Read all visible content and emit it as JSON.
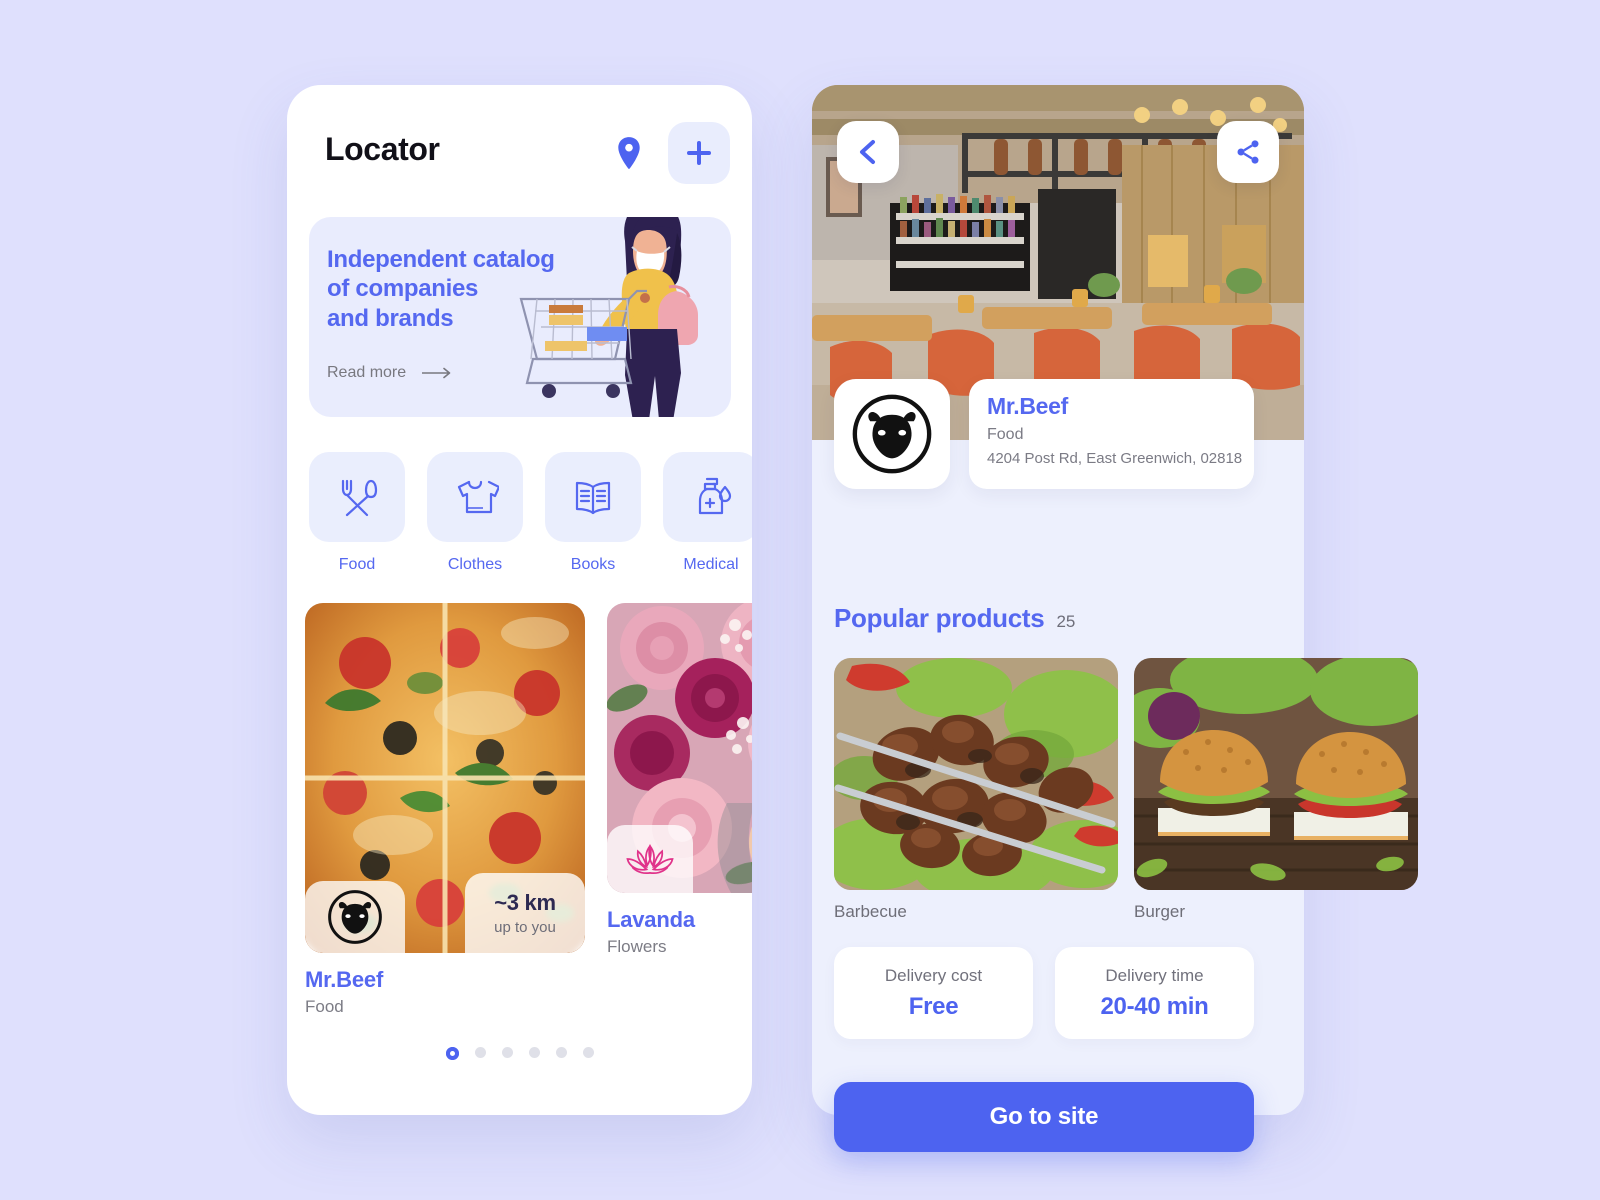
{
  "left_panel": {
    "app_title": "Locator",
    "header_icons": {
      "pin": "location-pin-icon",
      "add": "plus-icon"
    },
    "banner": {
      "title": "Independent catalog\nof companies\nand brands",
      "title_line1": "Independent catalog",
      "title_line2": "of companies",
      "title_line3": "and brands",
      "link_label": "Read more",
      "arrow": "arrow-right-icon",
      "illustration": "woman-with-shopping-cart"
    },
    "categories": [
      {
        "label": "Food",
        "icon": "fork-spoon-icon"
      },
      {
        "label": "Clothes",
        "icon": "tshirt-icon"
      },
      {
        "label": "Books",
        "icon": "open-book-icon"
      },
      {
        "label": "Medical",
        "icon": "sanitizer-bottle-icon"
      }
    ],
    "shops": [
      {
        "name": "Mr.Beef",
        "category": "Food",
        "logo": "cow-head-icon",
        "distance": "~3 km",
        "distance_sub": "up to you",
        "image": "pizza-photo"
      },
      {
        "name": "Lavanda",
        "category": "Flowers",
        "logo": "lotus-flower-icon",
        "image": "flower-bouquet-photo"
      }
    ],
    "pagination": {
      "total": 6,
      "active_index": 0
    }
  },
  "right_panel": {
    "hero": {
      "image": "restaurant-interior-photo",
      "back_icon": "chevron-left-icon",
      "share_icon": "share-icon"
    },
    "business": {
      "logo": "cow-head-icon",
      "name": "Mr.Beef",
      "category": "Food",
      "address": "4204 Post Rd, East Greenwich, 02818"
    },
    "popular": {
      "title": "Popular products",
      "count": "25",
      "items": [
        {
          "label": "Barbecue",
          "image": "barbecue-skewers-photo"
        },
        {
          "label": "Burger",
          "image": "burgers-photo"
        }
      ]
    },
    "delivery": [
      {
        "label": "Delivery cost",
        "value": "Free"
      },
      {
        "label": "Delivery time",
        "value": "20-40 min"
      }
    ],
    "cta_label": "Go to site"
  },
  "colors": {
    "page_background": "#dfe0fd",
    "accent_blue": "#4d63f0",
    "text_blue": "#5568f0",
    "panel_light": "#edf0fd",
    "tile_light": "#eaeefd",
    "muted_text": "#7b7b85"
  }
}
